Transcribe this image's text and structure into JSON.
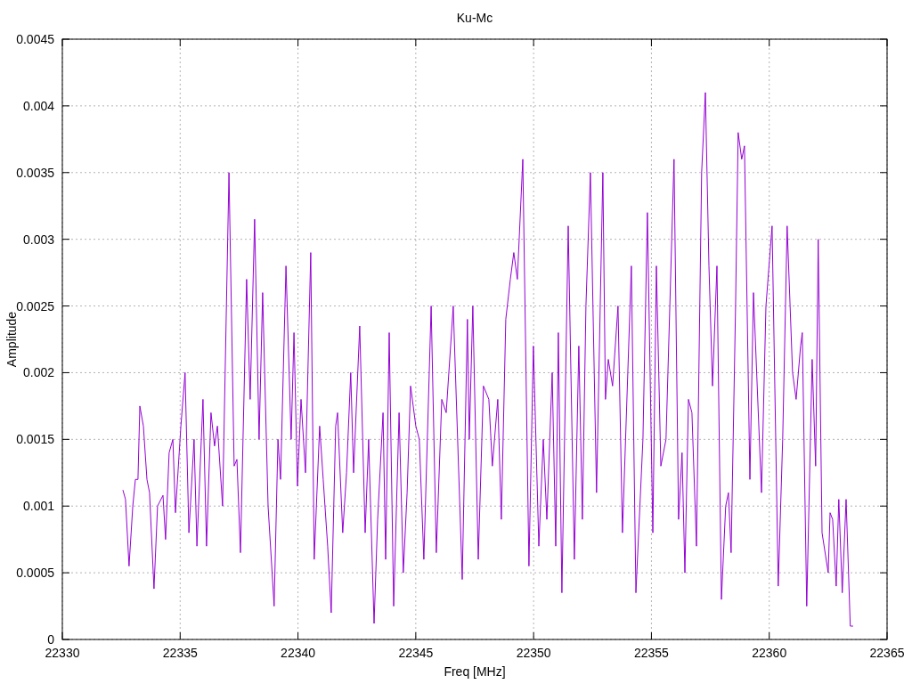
{
  "chart_data": {
    "type": "line",
    "title": "Ku-Mc",
    "xlabel": "Freq [MHz]",
    "ylabel": "Amplitude",
    "grid": true,
    "xlim": [
      22330,
      22365
    ],
    "ylim": [
      0,
      0.0045
    ],
    "xticks": [
      22330,
      22335,
      22340,
      22345,
      22350,
      22355,
      22360,
      22365
    ],
    "yticks": [
      0,
      0.0005,
      0.001,
      0.0015,
      0.002,
      0.0025,
      0.003,
      0.0035,
      0.004,
      0.0045
    ],
    "x": [
      22332.57,
      22332.68,
      22332.83,
      22332.99,
      22333.1,
      22333.21,
      22333.29,
      22333.44,
      22333.59,
      22333.7,
      22333.89,
      22334.04,
      22334.27,
      22334.38,
      22334.53,
      22334.69,
      22334.8,
      22335.03,
      22335.21,
      22335.37,
      22335.59,
      22335.71,
      22335.97,
      22336.12,
      22336.31,
      22336.46,
      22336.58,
      22336.8,
      22337.07,
      22337.29,
      22337.41,
      22337.56,
      22337.82,
      22337.97,
      22338.16,
      22338.35,
      22338.5,
      22338.73,
      22338.99,
      22339.15,
      22339.26,
      22339.49,
      22339.71,
      22339.83,
      22339.98,
      22340.13,
      22340.32,
      22340.54,
      22340.69,
      22340.92,
      22341.07,
      22341.26,
      22341.41,
      22341.6,
      22341.68,
      22341.9,
      22342.06,
      22342.24,
      22342.36,
      22342.62,
      22342.85,
      22343.0,
      22343.23,
      22343.38,
      22343.61,
      22343.72,
      22343.87,
      22344.06,
      22344.29,
      22344.47,
      22344.63,
      22344.78,
      22345.0,
      22345.15,
      22345.34,
      22345.65,
      22345.87,
      22346.1,
      22346.29,
      22346.59,
      22346.97,
      22347.19,
      22347.27,
      22347.42,
      22347.65,
      22347.87,
      22348.1,
      22348.25,
      22348.48,
      22348.63,
      22348.82,
      22349.01,
      22349.16,
      22349.31,
      22349.54,
      22349.8,
      22349.99,
      22350.22,
      22350.41,
      22350.56,
      22350.79,
      22350.94,
      22351.05,
      22351.2,
      22351.47,
      22351.73,
      22351.92,
      22352.07,
      22352.22,
      22352.41,
      22352.67,
      22352.94,
      22353.05,
      22353.17,
      22353.35,
      22353.58,
      22353.77,
      22354.15,
      22354.34,
      22354.64,
      22354.83,
      22355.06,
      22355.21,
      22355.4,
      22355.62,
      22355.96,
      22356.15,
      22356.3,
      22356.42,
      22356.57,
      22356.72,
      22356.91,
      22357.13,
      22357.29,
      22357.44,
      22357.59,
      22357.78,
      22357.97,
      22358.15,
      22358.27,
      22358.38,
      22358.57,
      22358.68,
      22358.83,
      22358.95,
      22359.18,
      22359.33,
      22359.67,
      22359.86,
      22360.12,
      22360.38,
      22360.57,
      22360.76,
      22360.99,
      22361.14,
      22361.33,
      22361.4,
      22361.59,
      22361.82,
      22361.97,
      22362.08,
      22362.24,
      22362.5,
      22362.58,
      22362.69,
      22362.84,
      22362.95,
      22363.1,
      22363.26,
      22363.44,
      22363.56
    ],
    "series": [
      {
        "color": "#9400d3",
        "values": [
          0.00112,
          0.00105,
          0.00055,
          0.001,
          0.0012,
          0.0012,
          0.00175,
          0.0016,
          0.0012,
          0.0011,
          0.00038,
          0.001,
          0.00108,
          0.00075,
          0.0014,
          0.0015,
          0.00095,
          0.0016,
          0.002,
          0.0008,
          0.0015,
          0.0007,
          0.0018,
          0.0007,
          0.0017,
          0.00145,
          0.0016,
          0.001,
          0.0035,
          0.0013,
          0.00135,
          0.00065,
          0.0027,
          0.0018,
          0.00315,
          0.0015,
          0.0026,
          0.001,
          0.00025,
          0.0015,
          0.0012,
          0.0028,
          0.0015,
          0.0023,
          0.00115,
          0.0018,
          0.00125,
          0.0029,
          0.0006,
          0.0016,
          0.0012,
          0.0007,
          0.0002,
          0.0016,
          0.0017,
          0.0008,
          0.00125,
          0.002,
          0.00125,
          0.00235,
          0.0008,
          0.0015,
          0.00012,
          0.0009,
          0.0017,
          0.0006,
          0.0023,
          0.00025,
          0.0017,
          0.0005,
          0.0011,
          0.0019,
          0.0016,
          0.0015,
          0.0006,
          0.0025,
          0.00065,
          0.0018,
          0.0017,
          0.0025,
          0.00045,
          0.0024,
          0.0015,
          0.0025,
          0.0006,
          0.0019,
          0.0018,
          0.0013,
          0.0018,
          0.0009,
          0.0024,
          0.0027,
          0.0029,
          0.0027,
          0.0036,
          0.00055,
          0.0022,
          0.0007,
          0.0015,
          0.0009,
          0.002,
          0.0007,
          0.0023,
          0.00035,
          0.0031,
          0.0006,
          0.0022,
          0.0009,
          0.0025,
          0.0035,
          0.0011,
          0.0035,
          0.0018,
          0.0021,
          0.0019,
          0.0025,
          0.0008,
          0.0028,
          0.00035,
          0.0015,
          0.0032,
          0.0008,
          0.0028,
          0.0013,
          0.0015,
          0.0036,
          0.0009,
          0.0014,
          0.0005,
          0.0018,
          0.0017,
          0.0007,
          0.0035,
          0.0041,
          0.0028,
          0.0019,
          0.0028,
          0.0003,
          0.001,
          0.0011,
          0.00065,
          0.0025,
          0.0038,
          0.0036,
          0.0037,
          0.0012,
          0.0026,
          0.0011,
          0.0025,
          0.0031,
          0.0004,
          0.0015,
          0.0031,
          0.002,
          0.0018,
          0.0022,
          0.0023,
          0.00025,
          0.0021,
          0.0013,
          0.003,
          0.0008,
          0.0005,
          0.00095,
          0.0009,
          0.0004,
          0.00105,
          0.00035,
          0.00105,
          0.0001,
          0.0001
        ]
      }
    ]
  }
}
